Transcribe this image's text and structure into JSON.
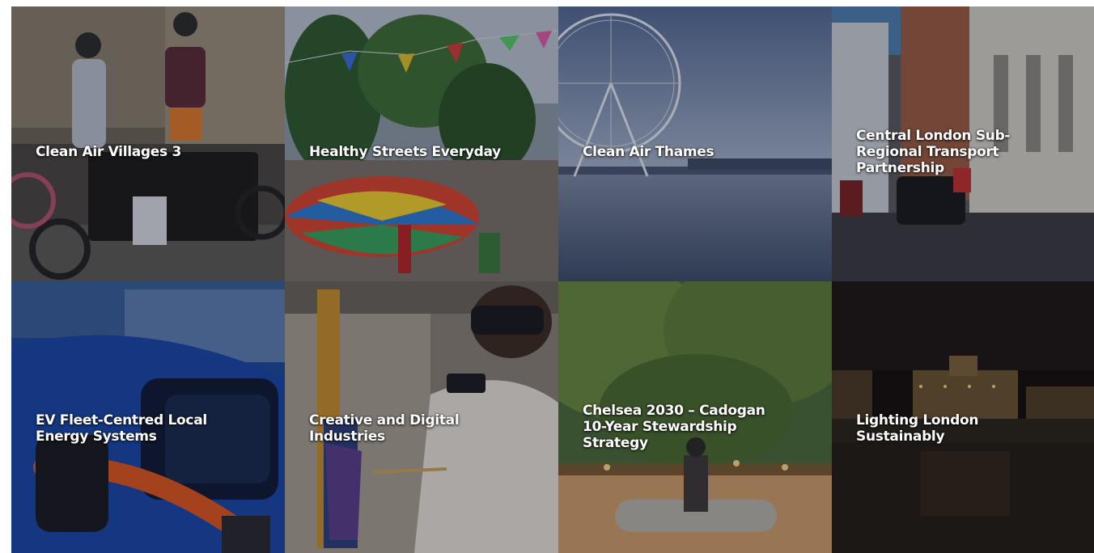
{
  "tiles": [
    {
      "title": "Clean Air Villages 3",
      "icon": "cycling-photo"
    },
    {
      "title": "Healthy Streets Everyday",
      "icon": "street-party-photo"
    },
    {
      "title": "Clean Air Thames",
      "icon": "london-eye-photo"
    },
    {
      "title": "Central London Sub-Regional Transport Partnership",
      "icon": "street-taxi-photo"
    },
    {
      "title": "EV Fleet-Centred Local Energy Systems",
      "icon": "ev-charger-photo"
    },
    {
      "title": "Creative and Digital Industries",
      "icon": "vr-painting-photo"
    },
    {
      "title": "Chelsea 2030 – Cadogan 10-Year Stewardship Strategy",
      "icon": "chelsea-square-photo"
    },
    {
      "title": "Lighting London Sustainably",
      "icon": "night-river-photo"
    }
  ]
}
